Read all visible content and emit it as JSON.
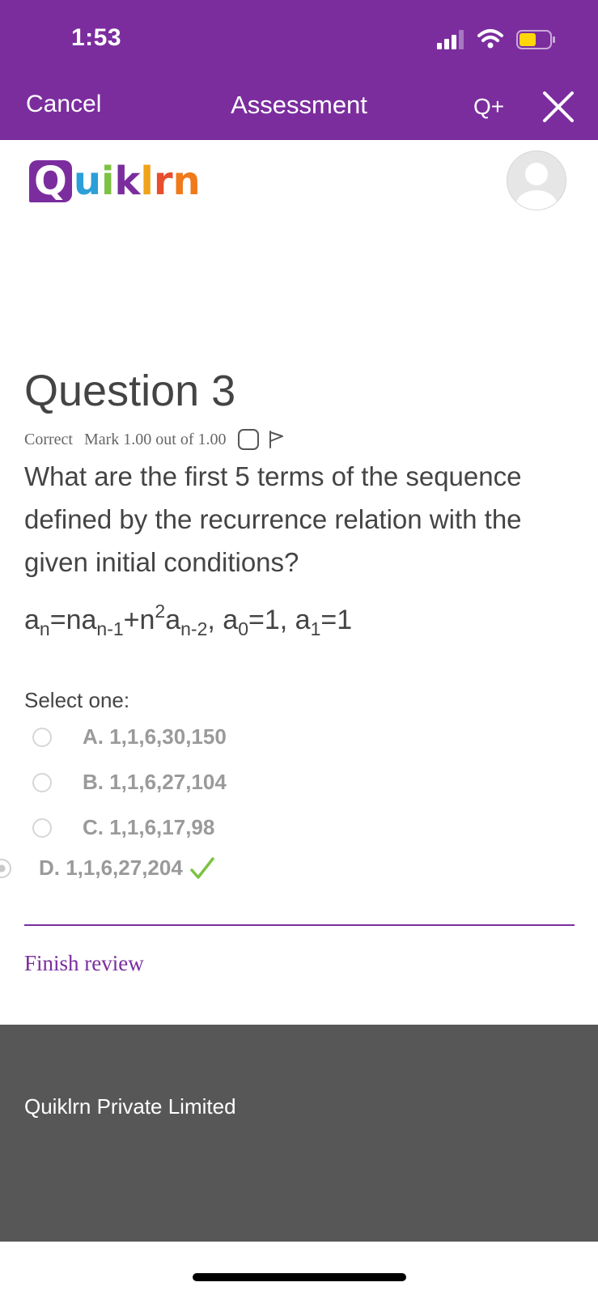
{
  "status_bar": {
    "time": "1:53"
  },
  "nav": {
    "cancel_label": "Cancel",
    "title": "Assessment",
    "qplus_label": "Q+"
  },
  "logo": {
    "text": "Quiklrn"
  },
  "question": {
    "title": "Question 3",
    "status": "Correct",
    "mark": "Mark 1.00 out of 1.00",
    "text": "What are the first 5 terms of the sequence defined by the recurrence relation with the given initial conditions?",
    "formula": {
      "a1": "a",
      "s1": "n",
      "t1": "=na",
      "s2": "n-1",
      "t2": "+n",
      "p1": "2",
      "t3": "a",
      "s3": "n-2",
      "t4": ", a",
      "s4": "0",
      "t5": "=1, a",
      "s5": "1",
      "t6": "=1"
    }
  },
  "select_label": "Select one:",
  "options": [
    {
      "label": "A. 1,1,6,30,150",
      "selected": false
    },
    {
      "label": "B. 1,1,6,27,104",
      "selected": false
    },
    {
      "label": "C. 1,1,6,17,98",
      "selected": false
    },
    {
      "label": "D. 1,1,6,27,204",
      "selected": true
    }
  ],
  "finish_label": "Finish review",
  "footer": {
    "company": "Quiklrn Private Limited"
  },
  "colors": {
    "brand": "#7b2d9e",
    "correct": "#7cc242",
    "footer_bg": "#575757"
  }
}
